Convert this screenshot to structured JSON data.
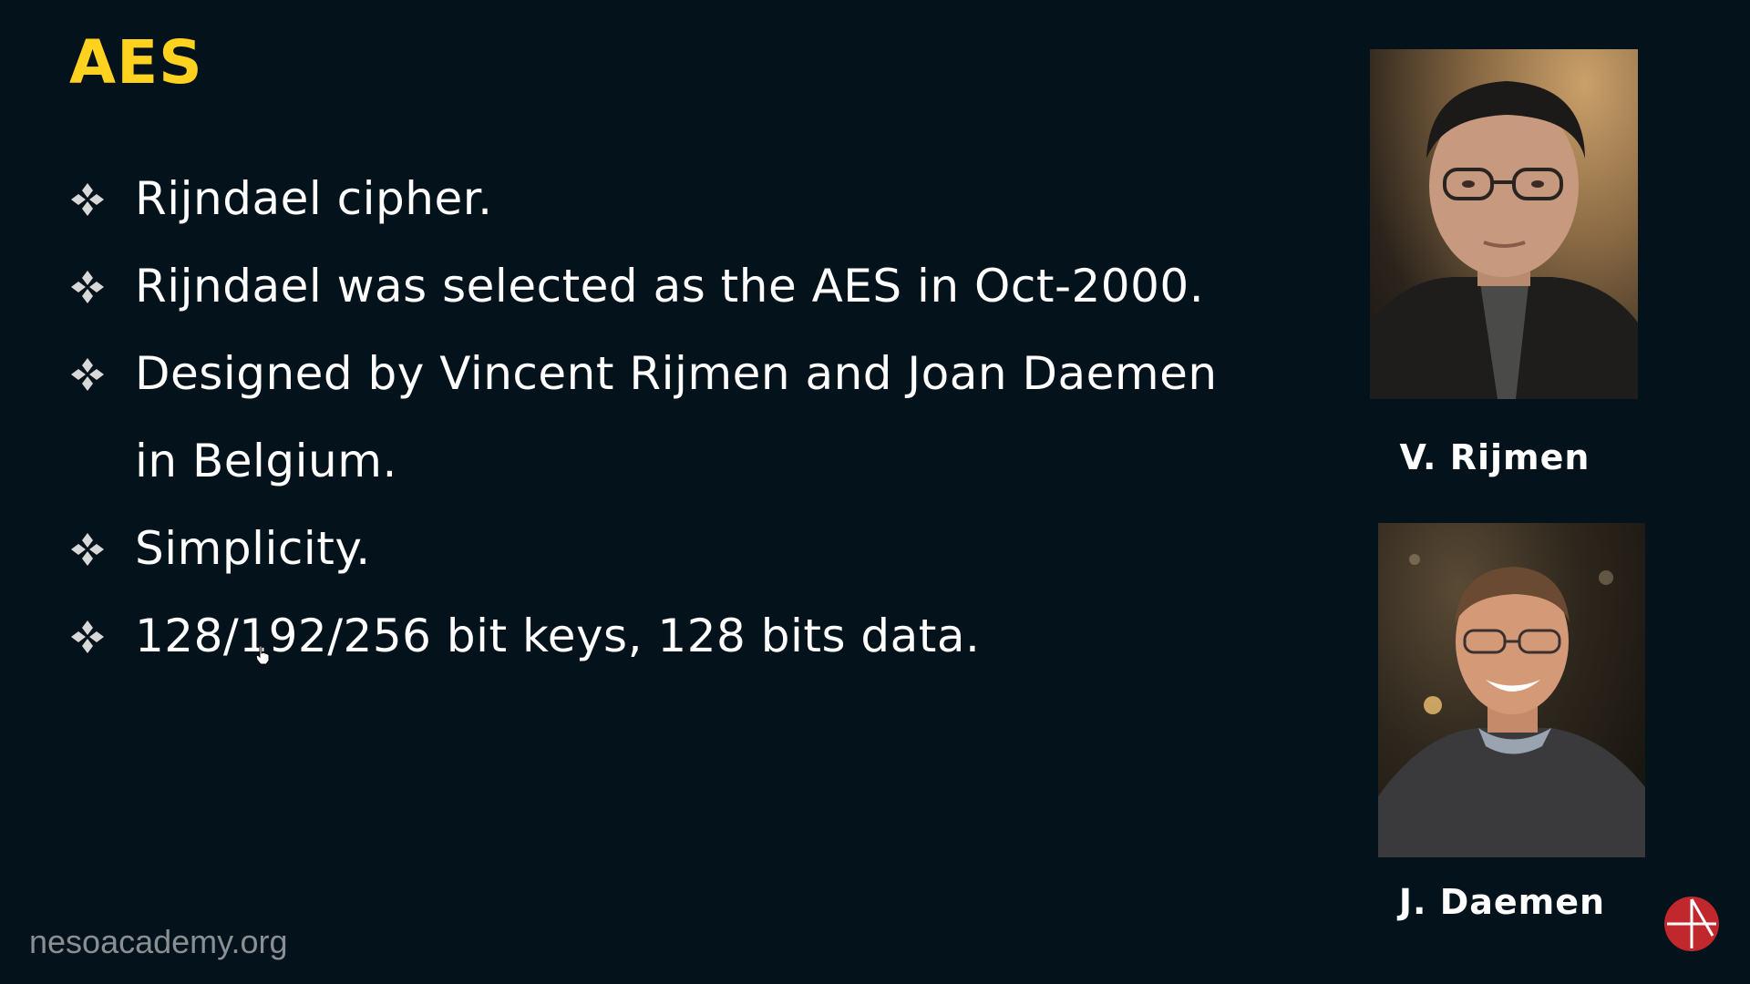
{
  "slide": {
    "title": "AES",
    "title_color": "#ffd21f",
    "background_color": "#04121b",
    "bullet_icon": "diamond-cluster-icon",
    "bullets": [
      "Rijndael cipher.",
      "Rijndael was selected as the AES in Oct-2000.",
      "Designed by Vincent Rijmen and Joan Daemen in Belgium.",
      "Simplicity.",
      "128/192/256 bit keys, 128 bits data."
    ]
  },
  "photos": {
    "rijmen_caption": "V. Rijmen",
    "daemen_caption": "J. Daemen"
  },
  "footer": {
    "watermark": "nesoacademy.org",
    "logo_icon": "neso-academy-logo-icon",
    "logo_color": "#c0282d"
  }
}
